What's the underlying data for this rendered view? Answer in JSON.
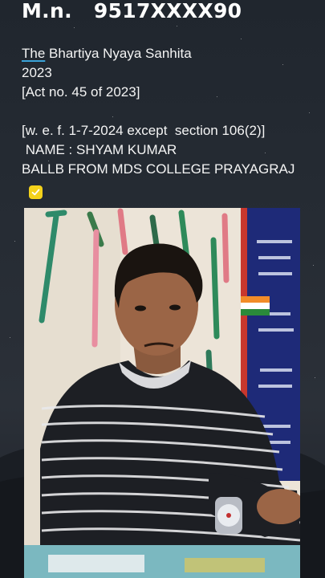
{
  "header": {
    "mobile_label": "M.n.",
    "mobile_number": "9517XXXX90"
  },
  "info": {
    "title_word_the": "The",
    "title_rest": "Bhartiya Nyaya Sanhita",
    "year": "2023",
    "act": "[Act no. 45 of 2023]",
    "wef": "[w. e. f. 1-7-2024 except  section 106(2)]",
    "name": " NAME : SHYAM KUMAR",
    "degree": "BALLB FROM MDS COLLEGE PRAYAGRAJ"
  },
  "icons": {
    "check": "check-mark-emoji"
  },
  "colors": {
    "accent_underline": "#3aa3d8",
    "check_emoji": "#f4d21b"
  }
}
